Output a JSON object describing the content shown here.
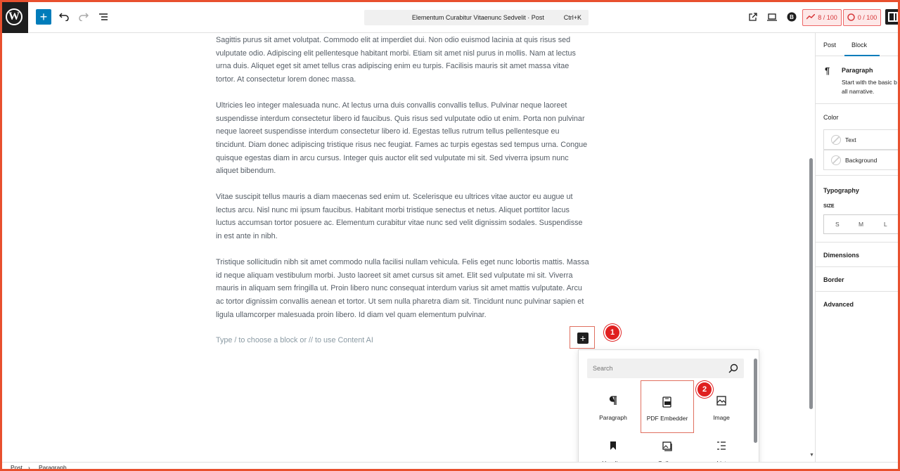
{
  "toolbar": {
    "doc_title": "Elementum Curabitur Vitaenunc Sedvelit · Post",
    "shortcut": "Ctrl+K",
    "seo_score": "8 / 100",
    "readability_score": "0 / 100",
    "add_label": "+"
  },
  "content": {
    "paragraphs": [
      "Sagittis purus sit amet volutpat. Commodo elit at imperdiet dui. Non odio euismod lacinia at quis risus sed vulputate odio. Adipiscing elit pellentesque habitant morbi. Etiam sit amet nisl purus in mollis. Nam at lectus urna duis. Aliquet eget sit amet tellus cras adipiscing enim eu turpis. Facilisis mauris sit amet massa vitae tortor. At consectetur lorem donec massa.",
      "Ultricies leo integer malesuada nunc. At lectus urna duis convallis convallis tellus. Pulvinar neque laoreet suspendisse interdum consectetur libero id faucibus. Quis risus sed vulputate odio ut enim. Porta non pulvinar neque laoreet suspendisse interdum consectetur libero id. Egestas tellus rutrum tellus pellentesque eu tincidunt. Diam donec adipiscing tristique risus nec feugiat. Fames ac turpis egestas sed tempus urna. Congue quisque egestas diam in arcu cursus. Integer quis auctor elit sed vulputate mi sit. Sed viverra ipsum nunc aliquet bibendum.",
      "Vitae suscipit tellus mauris a diam maecenas sed enim ut. Scelerisque eu ultrices vitae auctor eu augue ut lectus arcu. Nisl nunc mi ipsum faucibus. Habitant morbi tristique senectus et netus. Aliquet porttitor lacus luctus accumsan tortor posuere ac. Elementum curabitur vitae nunc sed velit dignissim sodales. Suspendisse in est ante in nibh.",
      "Tristique sollicitudin nibh sit amet commodo nulla facilisi nullam vehicula. Felis eget nunc lobortis mattis. Massa id neque aliquam vestibulum morbi. Justo laoreet sit amet cursus sit amet. Elit sed vulputate mi sit. Viverra mauris in aliquam sem fringilla ut. Proin libero nunc consequat interdum varius sit amet mattis vulputate. Arcu ac tortor dignissim convallis aenean et tortor. Ut sem nulla pharetra diam sit. Tincidunt nunc pulvinar sapien et ligula ullamcorper malesuada proin libero. Id diam vel quam elementum pulvinar."
    ],
    "placeholder": "Type / to choose a block or // to use Content AI"
  },
  "inserter": {
    "search_placeholder": "Search",
    "step1": "1",
    "step2": "2",
    "blocks": [
      {
        "label": "Paragraph",
        "icon": "pilcrow-icon"
      },
      {
        "label": "PDF Embedder",
        "icon": "pdf-icon"
      },
      {
        "label": "Image",
        "icon": "image-icon"
      },
      {
        "label": "Heading",
        "icon": "bookmark-icon"
      },
      {
        "label": "Gallery",
        "icon": "gallery-icon"
      },
      {
        "label": "List",
        "icon": "list-icon"
      }
    ]
  },
  "sidebar": {
    "tab_post": "Post",
    "tab_block": "Block",
    "block_name": "Paragraph",
    "block_desc_1": "Start with the basic b",
    "block_desc_2": "all narrative.",
    "color_heading": "Color",
    "color_text": "Text",
    "color_background": "Background",
    "typography_heading": "Typography",
    "size_label": "SIZE",
    "size_s": "S",
    "size_m": "M",
    "size_l": "L",
    "dimensions": "Dimensions",
    "border": "Border",
    "advanced": "Advanced"
  },
  "footer": {
    "crumb_post": "Post",
    "crumb_separator": "›",
    "crumb_paragraph": "Paragraph"
  },
  "colors": {
    "accent": "#007cba",
    "annotation": "#e02020",
    "frame": "#e8502e"
  }
}
